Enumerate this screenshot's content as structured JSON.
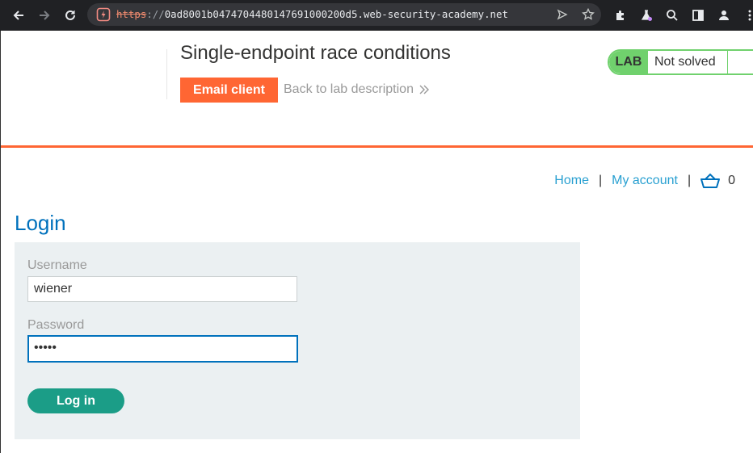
{
  "browser": {
    "url_scheme": "https",
    "url_separator": "://",
    "url_host": "0ad8001b047470448014769100020 0d5.web-security-academy.net",
    "url_display": "0ad8001b0474704480147691000200d5.web-security-academy.net"
  },
  "lab": {
    "title": "Single-endpoint race conditions",
    "email_client_label": "Email client",
    "back_link_label": "Back to lab description",
    "lab_tag": "LAB",
    "status_text": "Not solved"
  },
  "nav": {
    "home": "Home",
    "separator": "|",
    "my_account": "My account",
    "cart_count": "0"
  },
  "login": {
    "title": "Login",
    "username_label": "Username",
    "username_value": "wiener",
    "password_label": "Password",
    "password_value": "•••••",
    "submit_label": "Log in"
  },
  "colors": {
    "accent_orange": "#ff6633",
    "status_green": "#70d16d",
    "link_blue": "#29a0d1",
    "title_blue": "#0071bc",
    "button_teal": "#1b9d87"
  }
}
